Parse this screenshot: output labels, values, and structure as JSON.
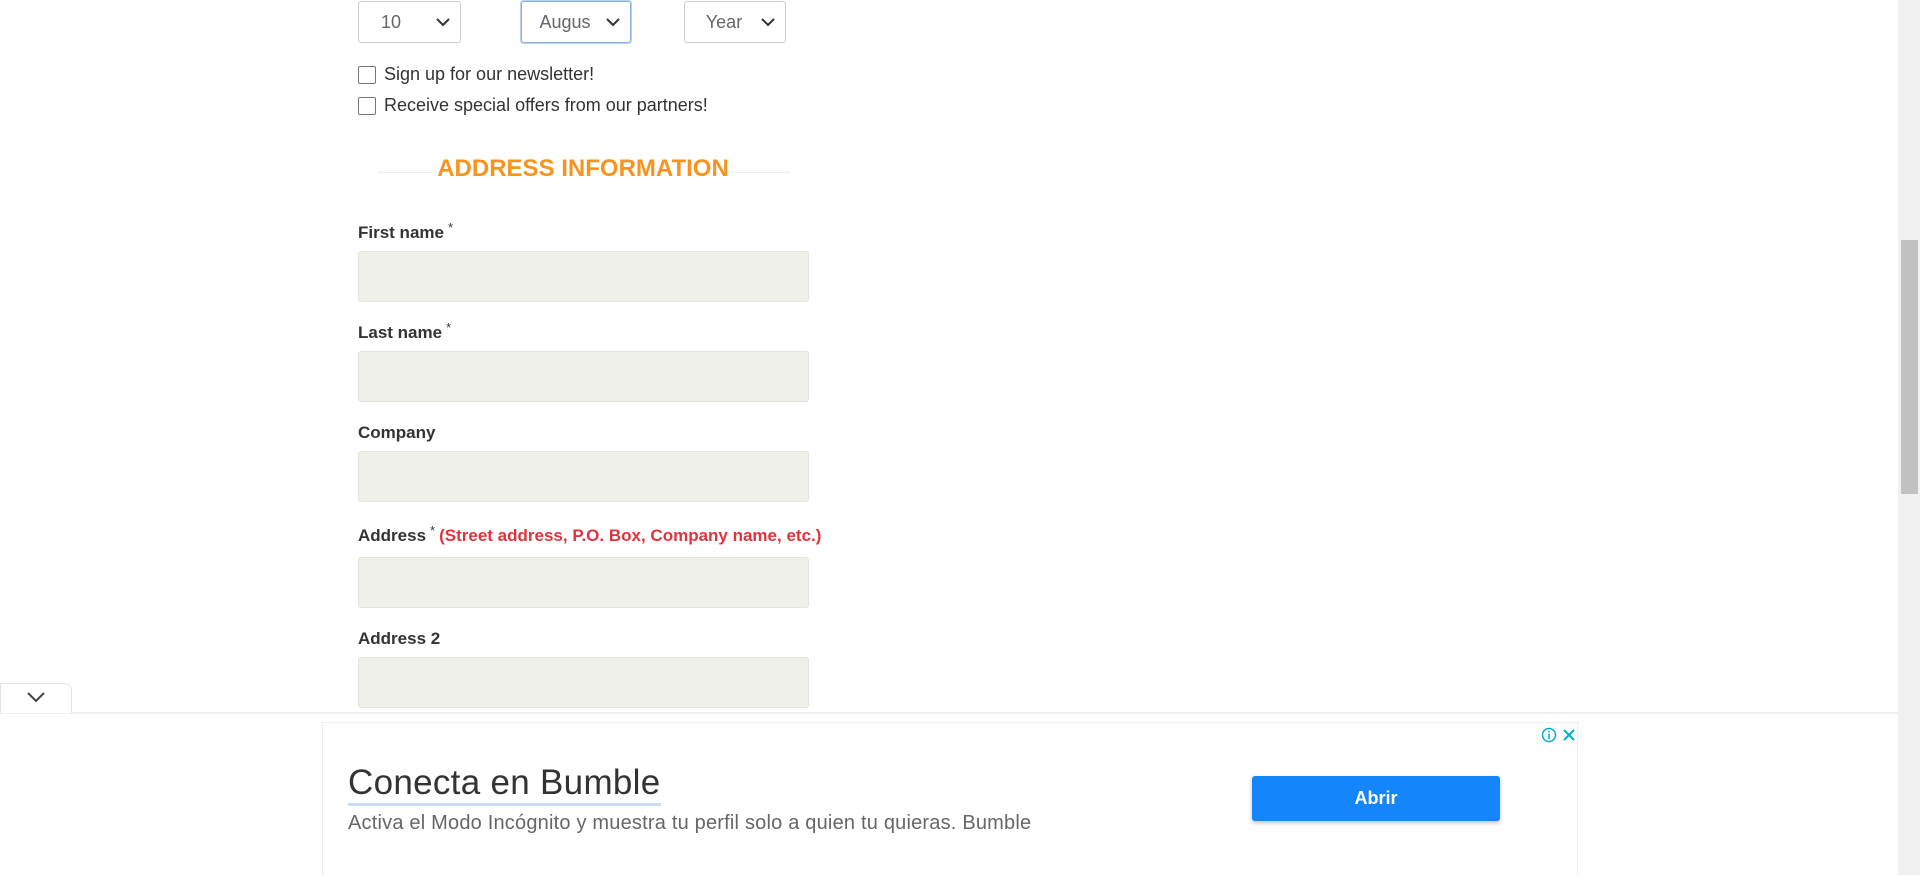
{
  "date_of_birth": {
    "day": "10",
    "month": "Augus",
    "year": "Year"
  },
  "checkboxes": {
    "newsletter": "Sign up for our newsletter!",
    "partner_offers": "Receive special offers from our partners!"
  },
  "section": {
    "heading": "ADDRESS INFORMATION",
    "accent_color": "#f7941d"
  },
  "fields": {
    "first_name": {
      "label": "First name",
      "required_mark": "*"
    },
    "last_name": {
      "label": "Last name",
      "required_mark": "*"
    },
    "company": {
      "label": "Company"
    },
    "address": {
      "label": "Address",
      "required_mark": "*",
      "hint": "(Street address, P.O. Box, Company name, etc.)"
    },
    "address2": {
      "label": "Address 2"
    }
  },
  "ad": {
    "title": "Conecta en Bumble",
    "text": "Activa el Modo Incógnito y muestra tu perfil solo a quien tu quieras. Bumble",
    "cta": "Abrir",
    "cta_color": "#1585fc",
    "icons": [
      "info-icon",
      "close-icon",
      "chevron-down-icon"
    ]
  }
}
